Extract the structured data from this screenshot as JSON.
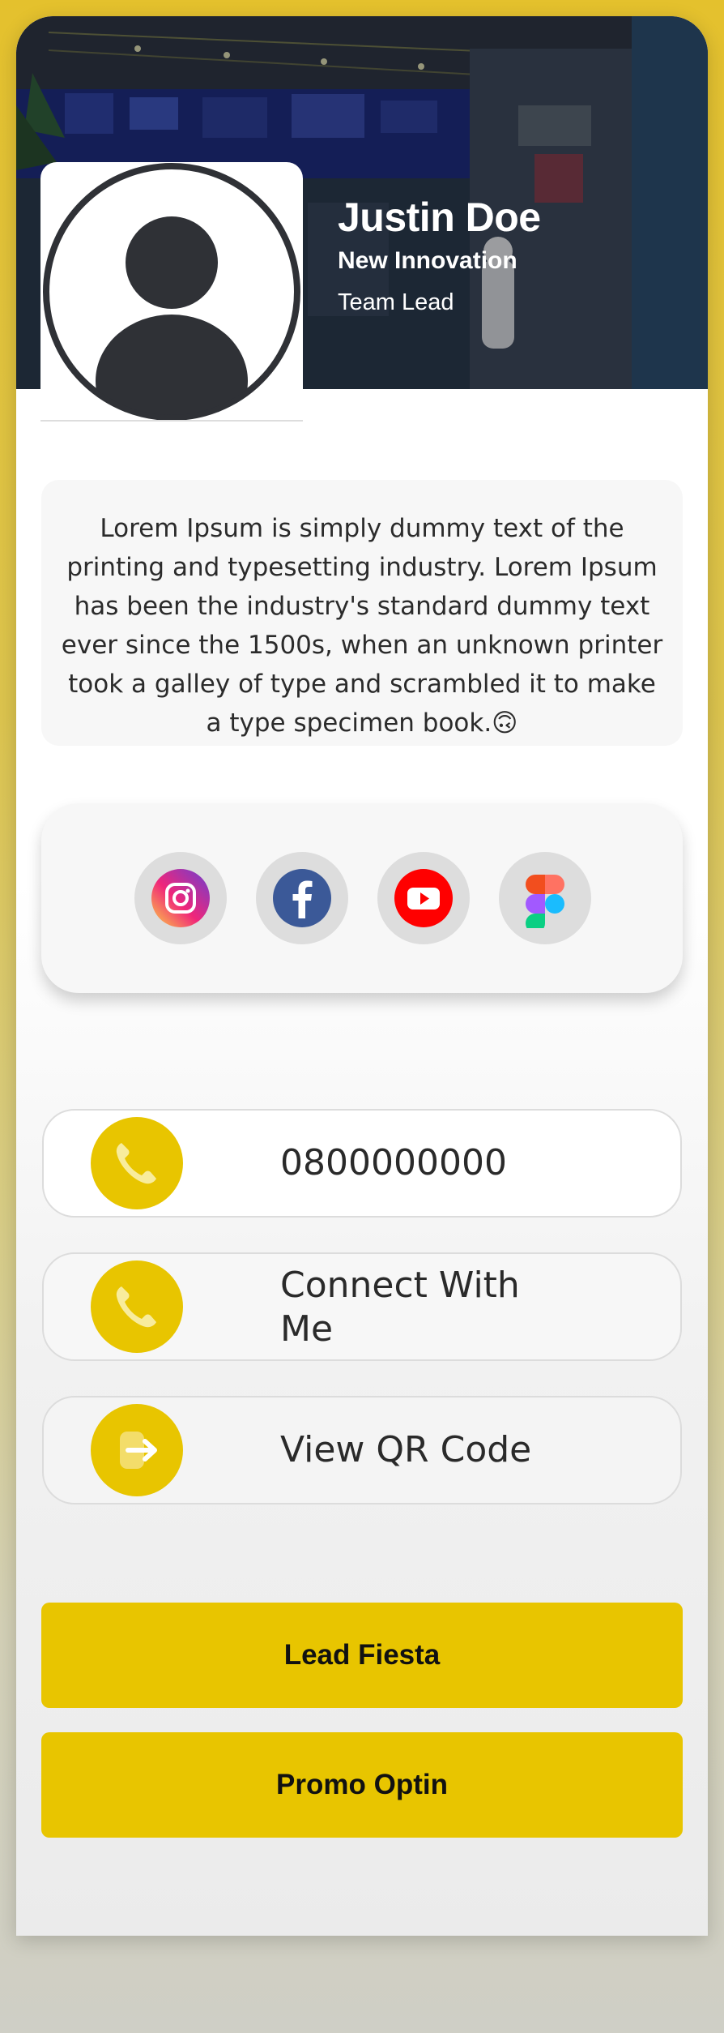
{
  "profile": {
    "name": "Justin Doe",
    "company": "New Innovation",
    "role": "Team Lead"
  },
  "bio": "Lorem Ipsum is simply dummy text of the printing and typesetting industry. Lorem Ipsum has been the industry's standard dummy text ever since the 1500s, when an unknown printer took a galley of type and scrambled it to make a type specimen book.🙃",
  "social": [
    {
      "icon": "instagram-icon"
    },
    {
      "icon": "facebook-icon"
    },
    {
      "icon": "youtube-icon"
    },
    {
      "icon": "figma-icon"
    }
  ],
  "contacts": [
    {
      "icon": "phone-icon",
      "label": "0800000000"
    },
    {
      "icon": "phone-icon",
      "label": "Connect With Me"
    },
    {
      "icon": "login-arrow-icon",
      "label": "View QR Code"
    }
  ],
  "buttons": {
    "lead_fiesta": "Lead Fiesta",
    "promo_optin": "Promo Optin"
  },
  "colors": {
    "accent": "#e8c500",
    "page_background": "#e4c12d",
    "card_background": "#ffffff",
    "text": "#2a2a2a"
  }
}
